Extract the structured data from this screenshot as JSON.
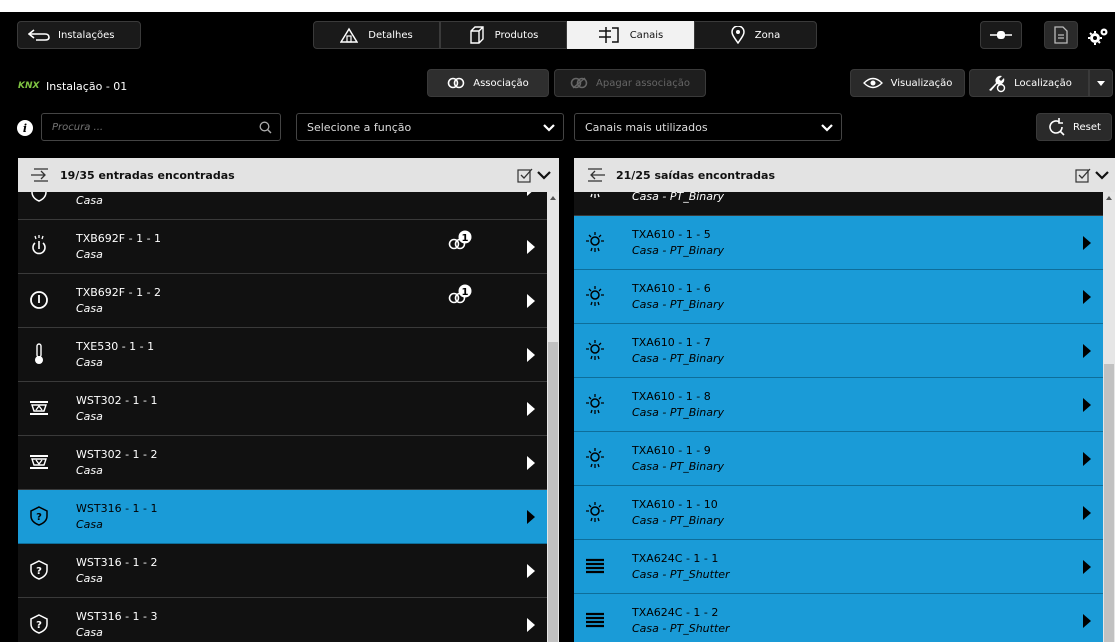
{
  "nav": {
    "back_label": "Instalações",
    "tabs": [
      {
        "label": "Detalhes",
        "icon": "house-icon"
      },
      {
        "label": "Produtos",
        "icon": "box-icon"
      },
      {
        "label": "Canais",
        "icon": "channels-icon"
      },
      {
        "label": "Zona",
        "icon": "location-pin-icon"
      }
    ],
    "active_tab": "Canais"
  },
  "toolbar": {
    "installation_brand": "KNX",
    "installation_name": "Instalação - 01",
    "associate_label": "Associação",
    "delete_association_label": "Apagar associação",
    "view_label": "Visualização",
    "location_label": "Localização"
  },
  "filters": {
    "search_placeholder": "Procura ...",
    "function_select": "Selecione a função",
    "channels_select": "Canais mais utilizados",
    "reset_label": "Reset"
  },
  "inputs_panel": {
    "title": "19/35 entradas encontradas",
    "items": [
      {
        "name": "",
        "sub": "Casa",
        "icon": "shield-icon",
        "selected": false
      },
      {
        "name": "TXB692F - 1 - 1",
        "sub": "Casa",
        "icon": "touch-icon",
        "selected": false,
        "badge": "1"
      },
      {
        "name": "TXB692F - 1 - 2",
        "sub": "Casa",
        "icon": "power-icon",
        "selected": false,
        "badge": "1"
      },
      {
        "name": "TXE530 - 1 - 1",
        "sub": "Casa",
        "icon": "thermometer-icon",
        "selected": false
      },
      {
        "name": "WST302 - 1 - 1",
        "sub": "Casa",
        "icon": "shutter-up-icon",
        "selected": false
      },
      {
        "name": "WST302 - 1 - 2",
        "sub": "Casa",
        "icon": "shutter-down-icon",
        "selected": false
      },
      {
        "name": "WST316 - 1 - 1",
        "sub": "Casa",
        "icon": "question-shield-icon",
        "selected": true
      },
      {
        "name": "WST316 - 1 - 2",
        "sub": "Casa",
        "icon": "question-shield-icon",
        "selected": false
      },
      {
        "name": "WST316 - 1 - 3",
        "sub": "Casa",
        "icon": "question-shield-icon",
        "selected": false
      }
    ]
  },
  "outputs_panel": {
    "title": "21/25 saídas encontradas",
    "items": [
      {
        "name": "",
        "sub": "Casa - PT_Binary",
        "icon": "lamp-icon",
        "selected": false
      },
      {
        "name": "TXA610 - 1 - 5",
        "sub": "Casa - PT_Binary",
        "icon": "lamp-icon",
        "selected": true
      },
      {
        "name": "TXA610 - 1 - 6",
        "sub": "Casa - PT_Binary",
        "icon": "lamp-icon",
        "selected": true
      },
      {
        "name": "TXA610 - 1 - 7",
        "sub": "Casa - PT_Binary",
        "icon": "lamp-icon",
        "selected": true
      },
      {
        "name": "TXA610 - 1 - 8",
        "sub": "Casa - PT_Binary",
        "icon": "lamp-icon",
        "selected": true
      },
      {
        "name": "TXA610 - 1 - 9",
        "sub": "Casa - PT_Binary",
        "icon": "lamp-icon",
        "selected": true
      },
      {
        "name": "TXA610 - 1 - 10",
        "sub": "Casa - PT_Binary",
        "icon": "lamp-icon",
        "selected": true
      },
      {
        "name": "TXA624C - 1 - 1",
        "sub": "Casa - PT_Shutter",
        "icon": "shutter-icon",
        "selected": true
      },
      {
        "name": "TXA624C - 1 - 2",
        "sub": "Casa - PT_Shutter",
        "icon": "shutter-icon",
        "selected": true
      }
    ]
  },
  "colors": {
    "accent": "#1a9bd7",
    "header_bg": "#e3e3e3",
    "background": "#000000"
  }
}
